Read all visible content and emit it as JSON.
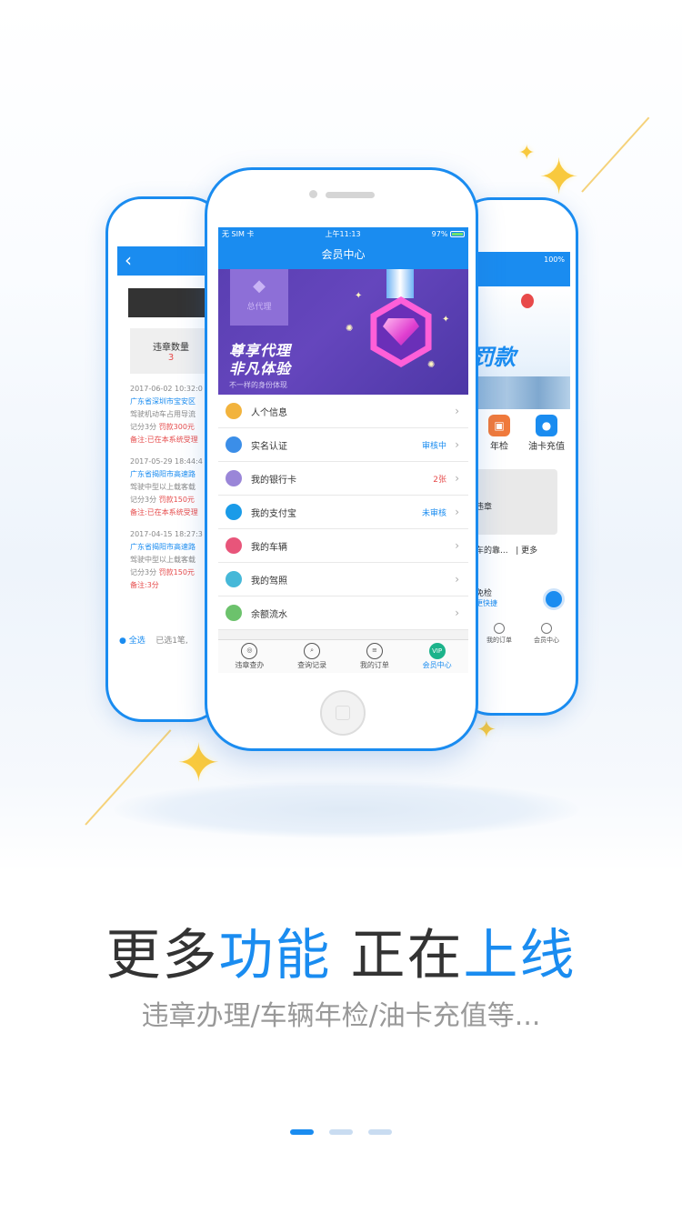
{
  "left_phone": {
    "box_label": "违章数量",
    "box_count": "3",
    "records": [
      {
        "date": "2017-06-02 10:32:0",
        "place": "广东省深圳市宝安区",
        "desc": "驾驶机动车占用导流",
        "points": "记分3分",
        "fine": "罚款300元",
        "note": "备注:已在本系统受理"
      },
      {
        "date": "2017-05-29 18:44:4",
        "place": "广东省揭阳市高速路",
        "desc": "驾驶中型以上载客载",
        "points": "记分3分",
        "fine": "罚款150元",
        "note": "备注:已在本系统受理"
      },
      {
        "date": "2017-04-15 18:27:3",
        "place": "广东省揭阳市高速路",
        "desc": "驾驶中型以上载客载",
        "points": "记分3分",
        "fine": "罚款150元",
        "note": "备注:3分"
      }
    ],
    "select_all": "全选",
    "selected": "已选1笔,"
  },
  "right_phone": {
    "status": "100%",
    "banner_text": "罚款",
    "icons": [
      "年检",
      "油卡充值"
    ],
    "card_label": "违章",
    "news": "车的靠...",
    "more": "| 更多",
    "exam_title": "免检",
    "exam_sub": "更快捷",
    "tabs": [
      "我的订单",
      "会员中心"
    ]
  },
  "center_phone": {
    "status_left": "无 SIM 卡",
    "status_time": "上午11:13",
    "status_battery": "97%",
    "title": "会员中心",
    "agent_label": "总代理",
    "banner_title_1": "尊享代理",
    "banner_title_2": "非凡体验",
    "banner_sub": "不一样的身份体现",
    "menu": [
      {
        "label": "人个信息",
        "value": "",
        "color": "#f2b33d"
      },
      {
        "label": "实名认证",
        "value": "审核中",
        "color": "#3b8ee8"
      },
      {
        "label": "我的银行卡",
        "value": "2张",
        "color": "#9a86d8"
      },
      {
        "label": "我的支付宝",
        "value": "未审核",
        "color": "#1a9be8"
      },
      {
        "label": "我的车辆",
        "value": "",
        "color": "#e8557a"
      },
      {
        "label": "我的驾照",
        "value": "",
        "color": "#46b8d8"
      },
      {
        "label": "余额流水",
        "value": "",
        "color": "#6cc26c"
      }
    ],
    "tabs": [
      {
        "label": "违章查办",
        "icon": "steering-icon"
      },
      {
        "label": "查询记录",
        "icon": "search-icon"
      },
      {
        "label": "我的订单",
        "icon": "order-icon"
      },
      {
        "label": "会员中心",
        "icon": "vip-icon",
        "badge": "VIP"
      }
    ]
  },
  "headline": {
    "part1": "更多",
    "part2": "功能",
    "part3": "正在",
    "part4": "上线"
  },
  "subline": "违章办理/车辆年检/油卡充值等...",
  "pager": {
    "count": 3,
    "active": 1
  },
  "colors": {
    "accent": "#1a8cf0",
    "banner": "#5a3fb2",
    "star": "#f8c93e"
  }
}
